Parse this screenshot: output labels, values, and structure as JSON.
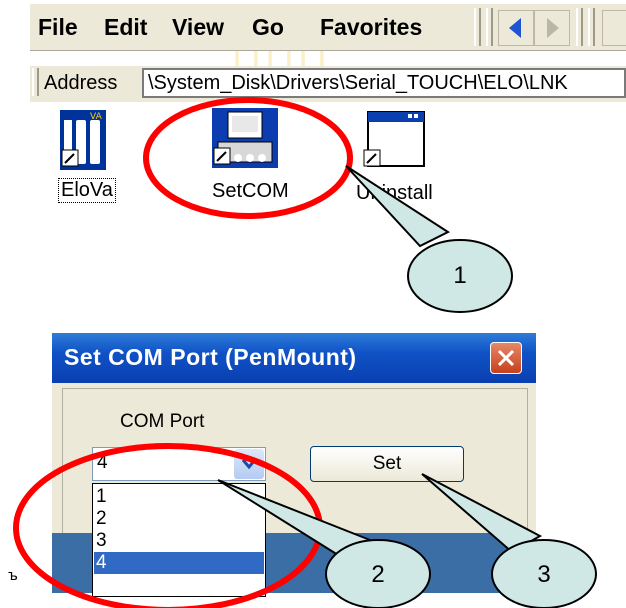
{
  "menubar": {
    "items": [
      "File",
      "Edit",
      "View",
      "Go",
      "Favorites"
    ],
    "underline": [
      "F",
      "E",
      "V",
      "G",
      "a"
    ]
  },
  "address": {
    "label": "Address",
    "value": "\\System_Disk\\Drivers\\Serial_TOUCH\\ELO\\LNK"
  },
  "icons": [
    {
      "name": "EloVa",
      "icon": "elova-app-icon"
    },
    {
      "name": "SetCOM",
      "icon": "setcom-computer-icon"
    },
    {
      "name": "Uninstall",
      "icon": "uninstall-window-icon"
    }
  ],
  "dialog": {
    "title": "Set COM Port (PenMount)",
    "com_label": "COM Port",
    "selected": "4",
    "set_label": "Set",
    "options": [
      "1",
      "2",
      "3",
      "4"
    ]
  },
  "callouts": [
    "1",
    "2",
    "3"
  ],
  "stray_mark": "ъ",
  "colors": {
    "callout_fill": "#cfe8e6",
    "annotation_red": "#ff0000",
    "title_blue": "#0f52c6",
    "selection_blue": "#316ac5"
  }
}
